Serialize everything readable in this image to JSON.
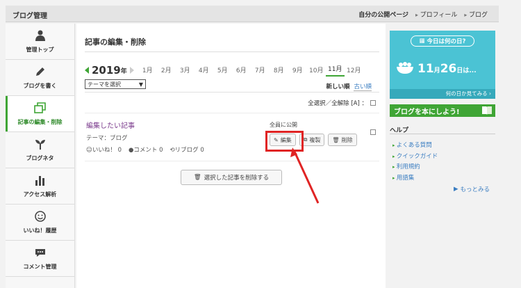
{
  "header": {
    "title": "ブログ管理",
    "my_page": "自分の公開ページ",
    "profile": "プロフィール",
    "blog": "ブログ"
  },
  "sidebar": {
    "items": [
      {
        "label": "管理トップ",
        "icon": "user-icon"
      },
      {
        "label": "ブログを書く",
        "icon": "pencil-icon"
      },
      {
        "label": "記事の編集・削除",
        "icon": "documents-icon",
        "active": true
      },
      {
        "label": "ブログネタ",
        "icon": "sprout-icon"
      },
      {
        "label": "アクセス解析",
        "icon": "bar-chart-icon"
      },
      {
        "label": "いいね！履歴",
        "icon": "smiley-icon"
      },
      {
        "label": "コメント管理",
        "icon": "comment-icon"
      }
    ]
  },
  "main": {
    "title": "記事の編集・削除",
    "year": "2019",
    "year_suffix": "年",
    "months": [
      "1月",
      "2月",
      "3月",
      "4月",
      "5月",
      "6月",
      "7月",
      "8月",
      "9月",
      "10月",
      "11月",
      "12月"
    ],
    "active_month": "11月",
    "theme_select": "テーマを選択",
    "sort_new": "新しい順",
    "sort_old": "古い順",
    "select_all": "全選択／全解除 [A] ：",
    "entry": {
      "title": "編集したい記事",
      "theme": "テーマ：ブログ",
      "likes": "いいね！ 0",
      "comments": "コメント 0",
      "reblogs": "リブログ 0",
      "status": "全員に公開",
      "edit": "編集",
      "copy": "複製",
      "delete": "削除"
    },
    "delete_selected": "選択した記事を削除する"
  },
  "right": {
    "banner_pill": "今日は何の日?",
    "banner_month": "11",
    "banner_month_unit": "月",
    "banner_day": "26",
    "banner_day_unit": "日は...",
    "banner_footer": "何の日か見てみる ›",
    "banner2": "ブログを本にしよう!",
    "help_title": "ヘルプ",
    "help_items": [
      "よくある質問",
      "クイックガイド",
      "利用規約",
      "用語集"
    ],
    "more": "もっとみる"
  },
  "colors": {
    "accent": "#3fa535",
    "link": "#3a7dc1",
    "highlight": "#e02424",
    "banner": "#4bc3d4"
  }
}
